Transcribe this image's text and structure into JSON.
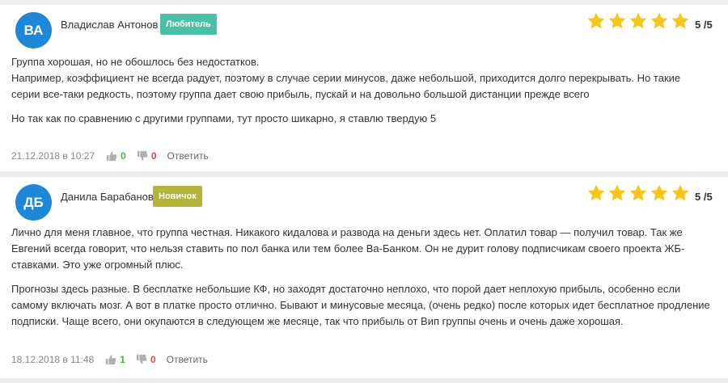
{
  "colors": {
    "avatar": "#1e88d6",
    "badge_lover": "#4bc0a4",
    "badge_novice": "#b4b33a",
    "star": "#f6c61c",
    "upvote": "#4caf50",
    "downvote": "#e04848"
  },
  "icons": {
    "star": "star-icon",
    "like": "thumbs-up-icon",
    "dislike": "thumbs-down-icon"
  },
  "reviews": [
    {
      "avatar_initials": "ВА",
      "author": "Владислав Антонов",
      "badge": "Любитель",
      "stars": 5,
      "rating": "5 /5",
      "paragraphs": [
        "Группа хорошая, но не обошлось без недостатков.\nНапример, коэффициент не всегда радует, поэтому в случае серии минусов, даже небольшой, приходится долго перекрывать. Но такие серии все-таки редкость, поэтому группа дает свою прибыль, пускай и на довольно большой дистанции прежде всего",
        "Но так как по сравнению с другими группами, тут просто шикарно, я ставлю твердую 5"
      ],
      "date": "21.12.2018 в 10:27",
      "likes": "0",
      "dislikes": "0",
      "reply_label": "Ответить"
    },
    {
      "avatar_initials": "ДБ",
      "author": "Данила Барабанов",
      "badge": "Новичок",
      "stars": 5,
      "rating": "5 /5",
      "paragraphs": [
        "Лично для меня главное, что группа честная. Никакого кидалова и развода на деньги здесь нет. Оплатил товар — получил товар. Так же Евгений всегда говорит, что нельзя ставить по пол банка или тем более Ва-Банком. Он не дурит голову подписчикам своего проекта ЖБ-ставками. Это уже огромный плюс.",
        "Прогнозы здесь разные. В бесплатке небольшие КФ, но заходят достаточно неплохо, что порой дает неплохую прибыль, особенно если самому включать мозг. А вот в платке просто отлично. Бывают и минусовые месяца, (очень редко) после которых идет бесплатное продление подписки. Чаще всего, они окупаются в следующем же месяце, так что прибыль от Вип группы очень и очень даже хорошая."
      ],
      "date": "18.12.2018 в 11:48",
      "likes": "1",
      "dislikes": "0",
      "reply_label": "Ответить"
    }
  ]
}
